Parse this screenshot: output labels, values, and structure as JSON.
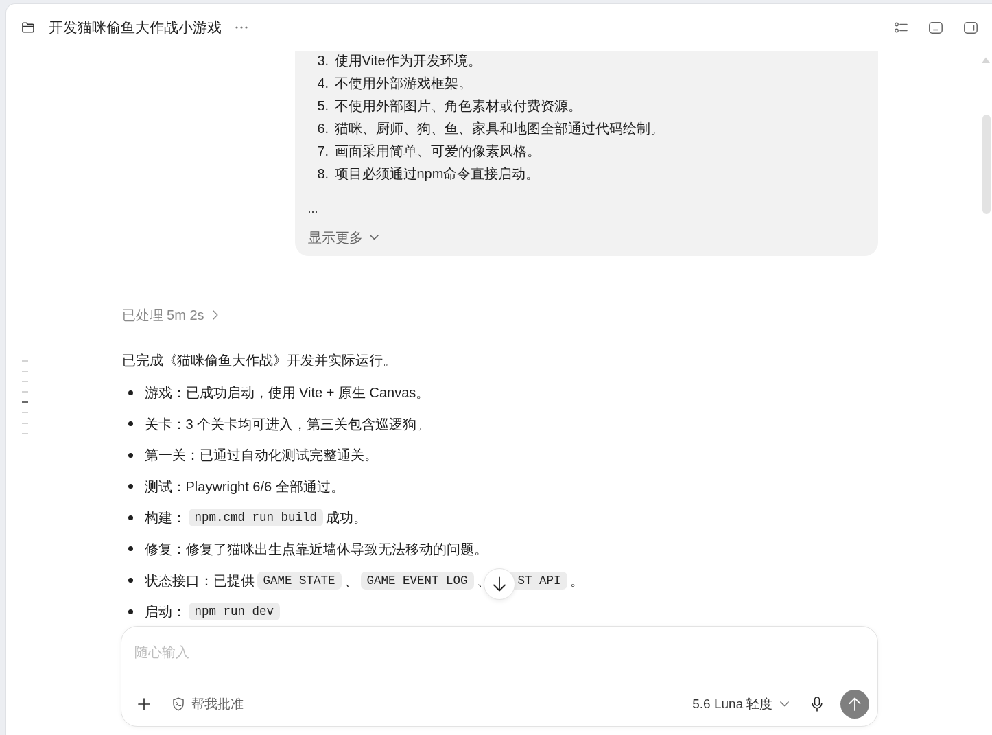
{
  "header": {
    "title": "开发猫咪偷鱼大作战小游戏"
  },
  "outline_markers": [
    {
      "selected": false
    },
    {
      "selected": false
    },
    {
      "selected": false
    },
    {
      "selected": false
    },
    {
      "selected": true
    },
    {
      "selected": false
    },
    {
      "selected": false
    },
    {
      "selected": false
    }
  ],
  "user_message": {
    "items": [
      {
        "number": "3.",
        "text": "使用Vite作为开发环境。"
      },
      {
        "number": "4.",
        "text": "不使用外部游戏框架。"
      },
      {
        "number": "5.",
        "text": "不使用外部图片、角色素材或付费资源。"
      },
      {
        "number": "6.",
        "text": "猫咪、厨师、狗、鱼、家具和地图全部通过代码绘制。"
      },
      {
        "number": "7.",
        "text": "画面采用简单、可爱的像素风格。"
      },
      {
        "number": "8.",
        "text": "项目必须通过npm命令直接启动。"
      }
    ],
    "ellipsis": "...",
    "show_more": "显示更多"
  },
  "processed": {
    "label": "已处理 5m 2s",
    "expanded": false
  },
  "reply": {
    "intro": "已完成《猫咪偷鱼大作战》开发并实际运行。",
    "bullets": [
      {
        "parts": [
          {
            "kind": "text",
            "text": "游戏：已成功启动，使用 Vite + 原生 Canvas。"
          }
        ]
      },
      {
        "parts": [
          {
            "kind": "text",
            "text": "关卡：3 个关卡均可进入，第三关包含巡逻狗。"
          }
        ]
      },
      {
        "parts": [
          {
            "kind": "text",
            "text": "第一关：已通过自动化测试完整通关。"
          }
        ]
      },
      {
        "parts": [
          {
            "kind": "text",
            "text": "测试：Playwright 6/6 全部通过。"
          }
        ]
      },
      {
        "parts": [
          {
            "kind": "text",
            "text": "构建："
          },
          {
            "kind": "code",
            "text": "npm.cmd run build"
          },
          {
            "kind": "text",
            "text": "成功。"
          }
        ]
      },
      {
        "parts": [
          {
            "kind": "text",
            "text": "修复：修复了猫咪出生点靠近墙体导致无法移动的问题。"
          }
        ]
      },
      {
        "parts": [
          {
            "kind": "text",
            "text": "状态接口：已提供"
          },
          {
            "kind": "code",
            "text": "GAME_STATE"
          },
          {
            "kind": "text",
            "text": "、"
          },
          {
            "kind": "code",
            "text": "GAME_EVENT_LOG"
          },
          {
            "kind": "text",
            "text": "、"
          },
          {
            "kind": "code_covered",
            "text": "ST_API"
          },
          {
            "kind": "text",
            "text": "。"
          }
        ]
      },
      {
        "parts": [
          {
            "kind": "text",
            "text": "启动："
          },
          {
            "kind": "code",
            "text": "npm run dev"
          }
        ]
      }
    ]
  },
  "composer": {
    "placeholder": "随心输入",
    "approve": "帮我批准",
    "model": "5.6 Luna 轻度"
  }
}
